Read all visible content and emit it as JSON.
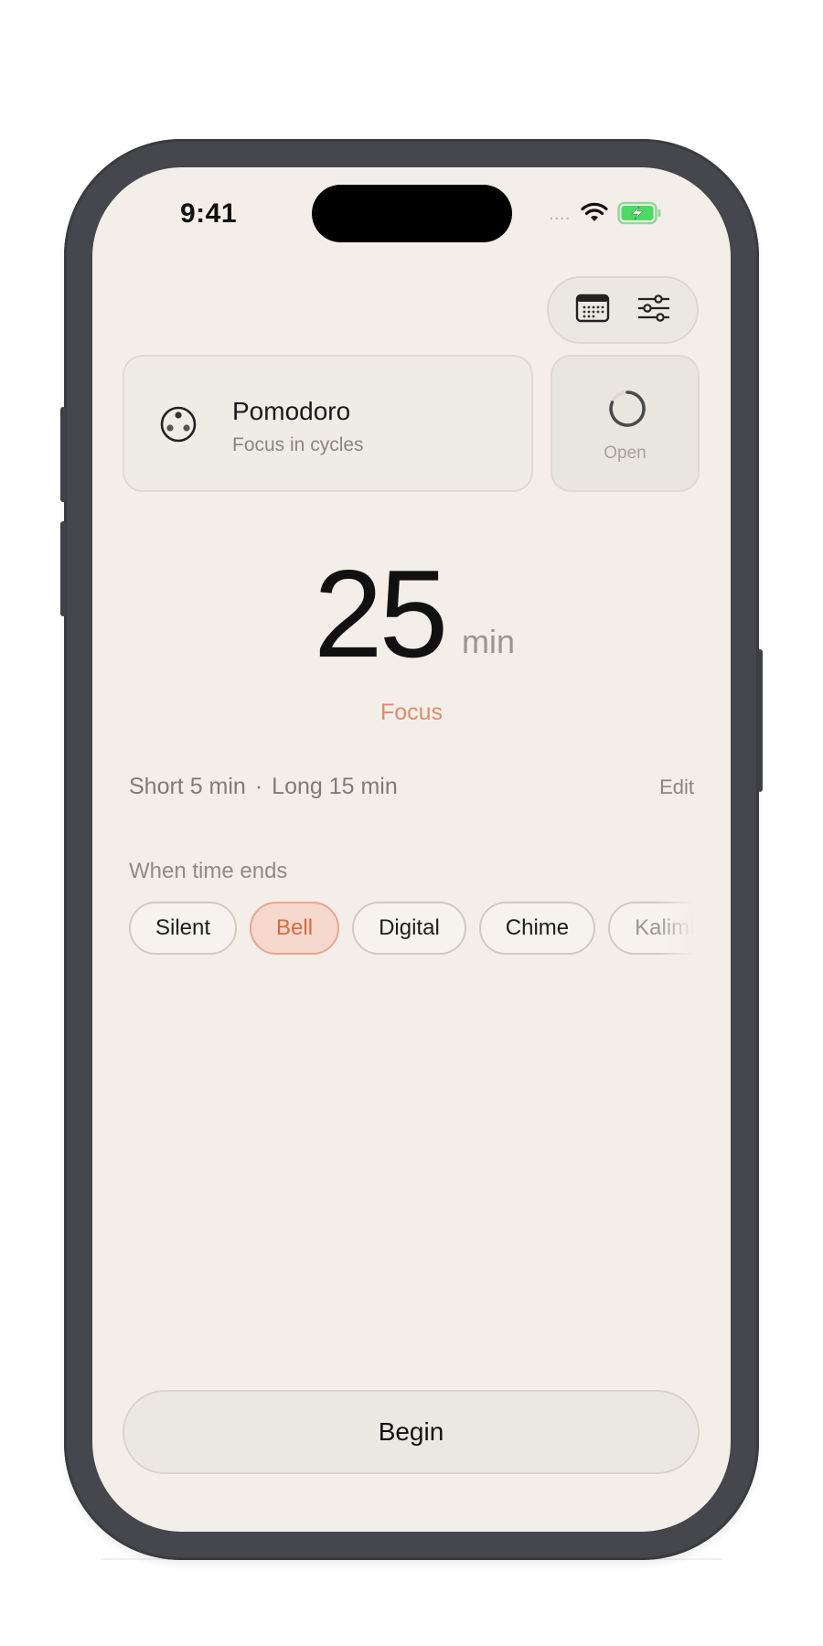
{
  "status_bar": {
    "time": "9:41",
    "signal_dots": "....",
    "icons": [
      "wifi-icon",
      "battery-charging-icon"
    ],
    "battery_color": "#4cd964"
  },
  "toolbar": {
    "icons": [
      "calendar-icon",
      "sliders-icon"
    ]
  },
  "mode_card": {
    "icon": "pomodoro-icon",
    "title": "Pomodoro",
    "subtitle": "Focus in cycles"
  },
  "open_card": {
    "icon": "loading-spinner-icon",
    "label": "Open"
  },
  "timer": {
    "value": "25",
    "unit": "min",
    "phase": "Focus"
  },
  "breaks": {
    "short": "Short 5 min",
    "separator": "·",
    "long": "Long 15 min",
    "edit_label": "Edit"
  },
  "sound": {
    "heading": "When time ends",
    "options": [
      "Silent",
      "Bell",
      "Digital",
      "Chime",
      "Kalimba"
    ],
    "selected": "Bell"
  },
  "actions": {
    "begin_label": "Begin"
  },
  "colors": {
    "background": "#f3efe8",
    "accent": "#e0896c",
    "selected_chip_bg": "#f6d8cc",
    "selected_chip_text": "#d9683f"
  }
}
